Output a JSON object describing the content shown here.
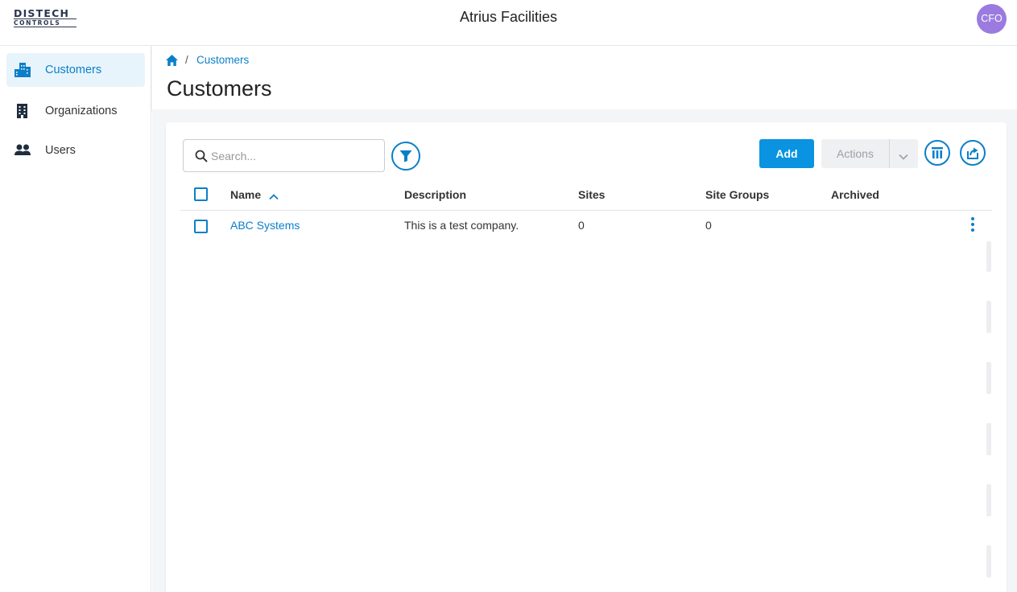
{
  "brand": {
    "line1": "DISTECH",
    "line2": "CONTROLS"
  },
  "app": {
    "title": "Atrius Facilities"
  },
  "user": {
    "initials": "CFO",
    "avatar_color": "#9b7be0"
  },
  "sidebar": {
    "items": [
      {
        "label": "Customers",
        "icon": "customers-icon",
        "active": true
      },
      {
        "label": "Organizations",
        "icon": "building-icon",
        "active": false
      },
      {
        "label": "Users",
        "icon": "users-icon",
        "active": false
      }
    ]
  },
  "breadcrumb": {
    "separator": "/",
    "current": "Customers"
  },
  "page": {
    "title": "Customers"
  },
  "toolbar": {
    "search_placeholder": "Search...",
    "add_label": "Add",
    "actions_label": "Actions"
  },
  "table": {
    "columns": [
      "Name",
      "Description",
      "Sites",
      "Site Groups",
      "Archived"
    ],
    "sort": {
      "column": "Name",
      "direction": "ascending"
    },
    "rows": [
      {
        "name": "ABC Systems",
        "description": "This is a test company.",
        "sites": "0",
        "site_groups": "0",
        "archived": ""
      }
    ]
  },
  "colors": {
    "accent": "#0a7fc9",
    "primary_button": "#0a93e0",
    "active_nav_bg": "#e8f4fc"
  }
}
